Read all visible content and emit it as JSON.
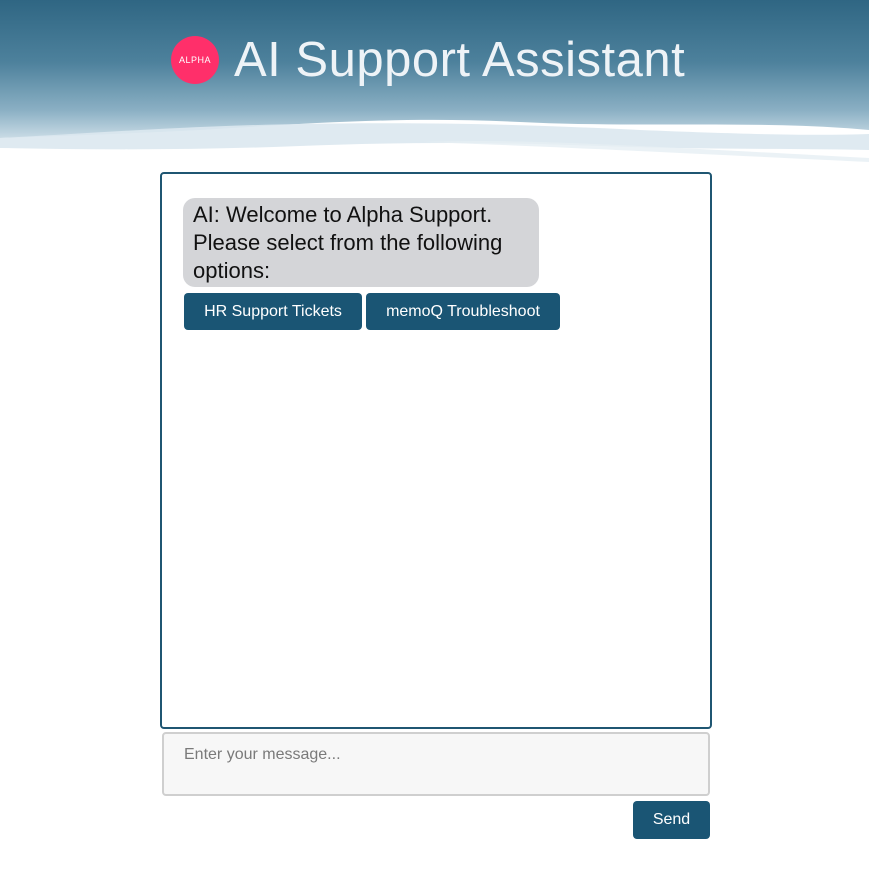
{
  "header": {
    "logo_text": "ALPHA",
    "title": "AI Support Assistant"
  },
  "chat": {
    "messages": [
      {
        "sender": "AI",
        "text": "AI: Welcome to Alpha Support. Please select from the following options:"
      }
    ],
    "options": [
      {
        "label": "HR Support Tickets"
      },
      {
        "label": "memoQ Troubleshoot"
      }
    ]
  },
  "composer": {
    "placeholder": "Enter your message...",
    "send_label": "Send"
  },
  "colors": {
    "accent": "#1a5574",
    "logo": "#ff2f6a",
    "bubble": "#d4d5d8"
  },
  "icons": {
    "logo": "alpha-logo-icon"
  }
}
